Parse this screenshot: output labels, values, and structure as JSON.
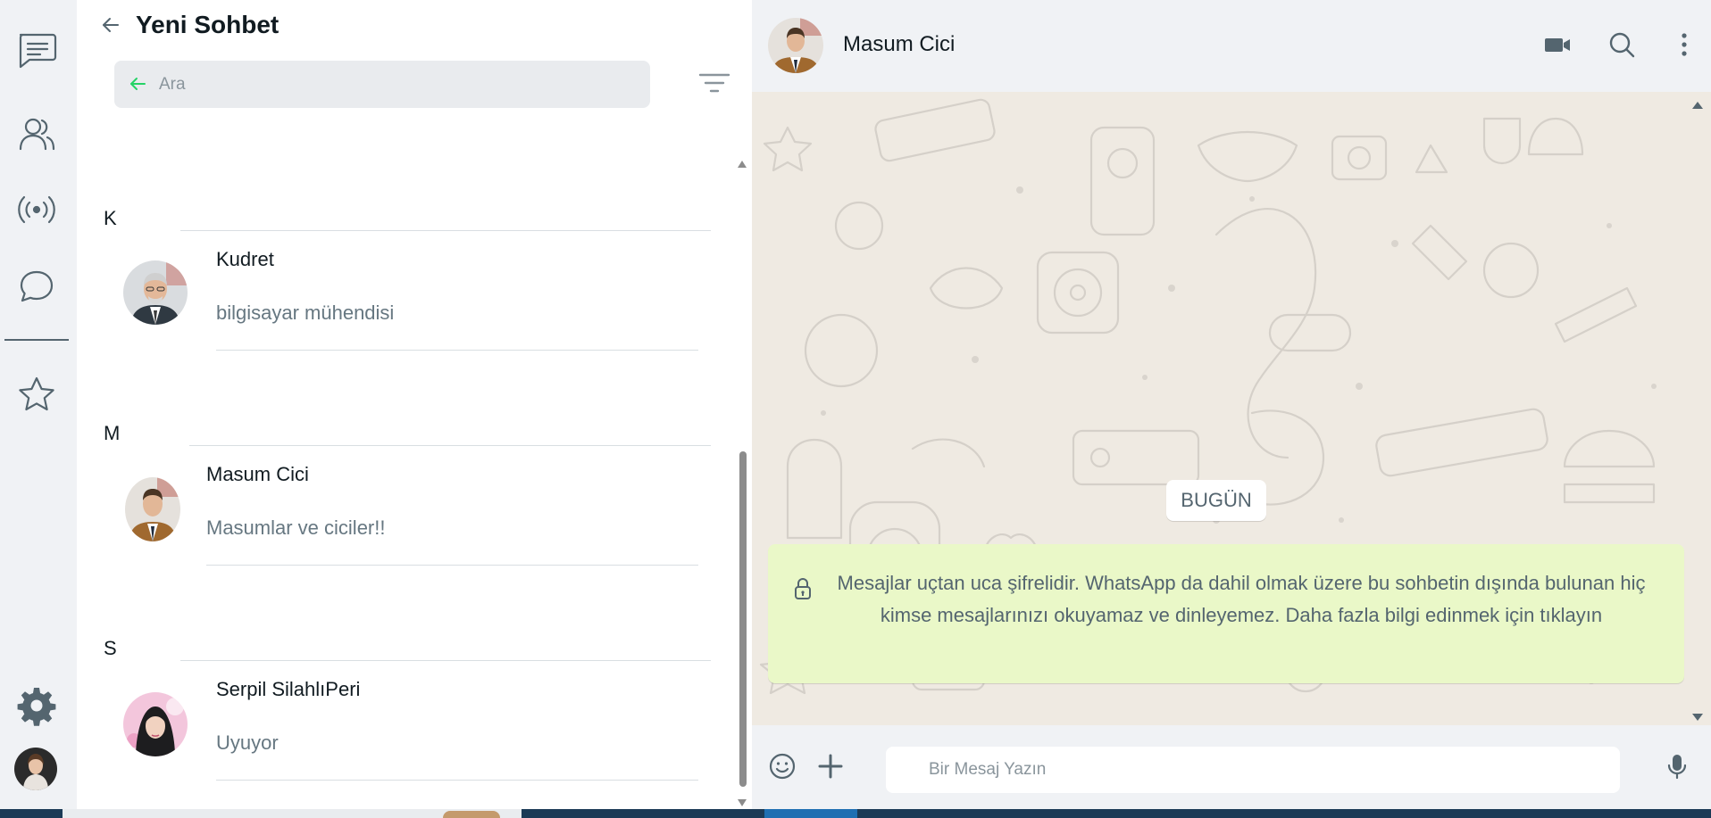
{
  "panel": {
    "title": "Yeni Sohbet",
    "search_placeholder": "Ara"
  },
  "contacts": [
    {
      "letter": "K",
      "name": "Kudret",
      "status": "bilgisayar mühendisi"
    },
    {
      "letter": "M",
      "name": "Masum Cici",
      "status": "Masumlar ve ciciler!!"
    },
    {
      "letter": "S",
      "name": "Serpil SilahlıPeri",
      "status": "Uyuyor"
    }
  ],
  "chat": {
    "contact_name": "Masum Cici",
    "date_badge": "BUGÜN",
    "encryption_notice": "Mesajlar uçtan uca şifrelidir. WhatsApp da dahil olmak üzere bu sohbetin dışında bulunan hiç kimse mesajlarınızı okuyamaz ve dinleyemez. Daha fazla bilgi edinmek için tıklayın",
    "message_placeholder": "Bir Mesaj Yazın"
  },
  "rail": {
    "icons": [
      "chats-icon",
      "contacts-icon",
      "broadcast-icon",
      "status-icon",
      "starred-icon",
      "settings-icon"
    ]
  },
  "colors": {
    "accent_green": "#25d366",
    "e2e_background": "#eaf8c8",
    "panel_background": "#ffffff",
    "chat_background": "#efeae2"
  }
}
